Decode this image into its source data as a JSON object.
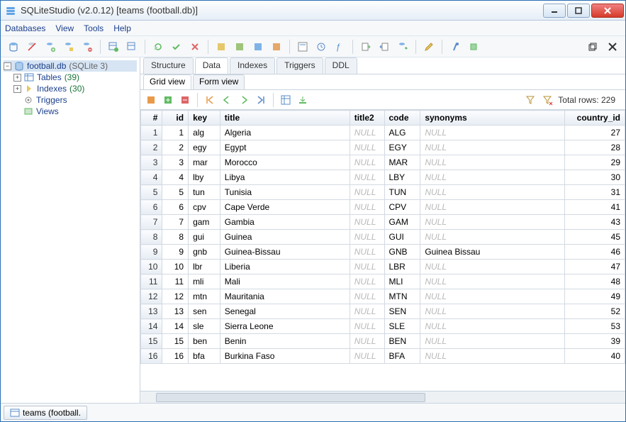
{
  "window": {
    "title": "SQLiteStudio (v2.0.12) [teams (football.db)]"
  },
  "menu": {
    "items": [
      "Databases",
      "View",
      "Tools",
      "Help"
    ]
  },
  "tree": {
    "db": {
      "name": "football.db",
      "engine": "(SQLite 3)"
    },
    "tables": {
      "label": "Tables",
      "count": "(39)"
    },
    "indexes": {
      "label": "Indexes",
      "count": "(30)"
    },
    "triggers": {
      "label": "Triggers"
    },
    "views": {
      "label": "Views"
    }
  },
  "tabs": {
    "items": [
      "Structure",
      "Data",
      "Indexes",
      "Triggers",
      "DDL"
    ],
    "active": 1
  },
  "subtabs": {
    "items": [
      "Grid view",
      "Form view"
    ],
    "active": 0
  },
  "totalRows": "Total rows: 229",
  "columns": [
    "#",
    "id",
    "key",
    "title",
    "title2",
    "code",
    "synonyms",
    "country_id"
  ],
  "rows": [
    {
      "n": 1,
      "id": 1,
      "key": "alg",
      "title": "Algeria",
      "title2": null,
      "code": "ALG",
      "synonyms": null,
      "country_id": 27
    },
    {
      "n": 2,
      "id": 2,
      "key": "egy",
      "title": "Egypt",
      "title2": null,
      "code": "EGY",
      "synonyms": null,
      "country_id": 28
    },
    {
      "n": 3,
      "id": 3,
      "key": "mar",
      "title": "Morocco",
      "title2": null,
      "code": "MAR",
      "synonyms": null,
      "country_id": 29
    },
    {
      "n": 4,
      "id": 4,
      "key": "lby",
      "title": "Libya",
      "title2": null,
      "code": "LBY",
      "synonyms": null,
      "country_id": 30
    },
    {
      "n": 5,
      "id": 5,
      "key": "tun",
      "title": "Tunisia",
      "title2": null,
      "code": "TUN",
      "synonyms": null,
      "country_id": 31
    },
    {
      "n": 6,
      "id": 6,
      "key": "cpv",
      "title": "Cape Verde",
      "title2": null,
      "code": "CPV",
      "synonyms": null,
      "country_id": 41
    },
    {
      "n": 7,
      "id": 7,
      "key": "gam",
      "title": "Gambia",
      "title2": null,
      "code": "GAM",
      "synonyms": null,
      "country_id": 43
    },
    {
      "n": 8,
      "id": 8,
      "key": "gui",
      "title": "Guinea",
      "title2": null,
      "code": "GUI",
      "synonyms": null,
      "country_id": 45
    },
    {
      "n": 9,
      "id": 9,
      "key": "gnb",
      "title": "Guinea-Bissau",
      "title2": null,
      "code": "GNB",
      "synonyms": "Guinea Bissau",
      "country_id": 46
    },
    {
      "n": 10,
      "id": 10,
      "key": "lbr",
      "title": "Liberia",
      "title2": null,
      "code": "LBR",
      "synonyms": null,
      "country_id": 47
    },
    {
      "n": 11,
      "id": 11,
      "key": "mli",
      "title": "Mali",
      "title2": null,
      "code": "MLI",
      "synonyms": null,
      "country_id": 48
    },
    {
      "n": 12,
      "id": 12,
      "key": "mtn",
      "title": "Mauritania",
      "title2": null,
      "code": "MTN",
      "synonyms": null,
      "country_id": 49
    },
    {
      "n": 13,
      "id": 13,
      "key": "sen",
      "title": "Senegal",
      "title2": null,
      "code": "SEN",
      "synonyms": null,
      "country_id": 52
    },
    {
      "n": 14,
      "id": 14,
      "key": "sle",
      "title": "Sierra Leone",
      "title2": null,
      "code": "SLE",
      "synonyms": null,
      "country_id": 53
    },
    {
      "n": 15,
      "id": 15,
      "key": "ben",
      "title": "Benin",
      "title2": null,
      "code": "BEN",
      "synonyms": null,
      "country_id": 39
    },
    {
      "n": 16,
      "id": 16,
      "key": "bfa",
      "title": "Burkina Faso",
      "title2": null,
      "code": "BFA",
      "synonyms": null,
      "country_id": 40
    }
  ],
  "status": {
    "tab": "teams (football."
  },
  "nullText": "NULL"
}
